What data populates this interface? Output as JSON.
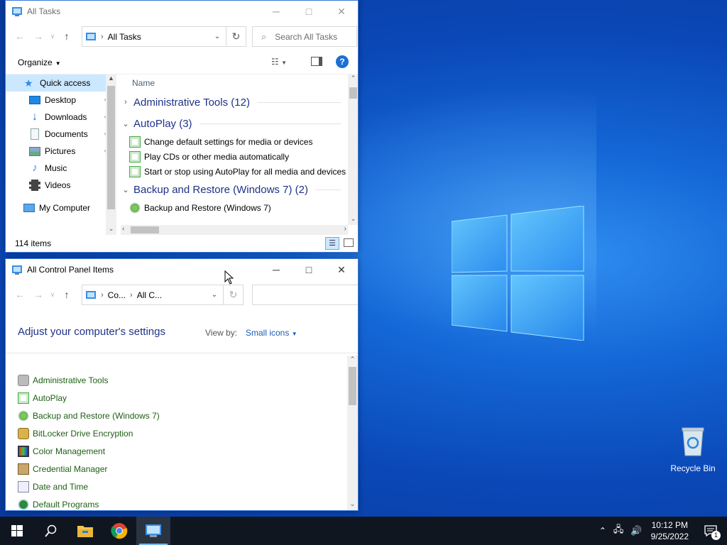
{
  "desktop": {
    "icons": [
      {
        "label": "Recycle Bin",
        "icon": "recycle-bin-icon"
      }
    ]
  },
  "all_tasks_window": {
    "title": "All Tasks",
    "address": {
      "crumbs": [
        "All Tasks"
      ]
    },
    "search_placeholder": "Search All Tasks",
    "toolbar": {
      "organize": "Organize"
    },
    "nav_pane": {
      "items": [
        {
          "label": "Quick access",
          "icon": "star-icon",
          "selected": true
        },
        {
          "label": "Desktop",
          "icon": "desktop-icon",
          "pinned": true
        },
        {
          "label": "Downloads",
          "icon": "download-arrow-icon",
          "pinned": true
        },
        {
          "label": "Documents",
          "icon": "document-icon",
          "pinned": true
        },
        {
          "label": "Pictures",
          "icon": "pictures-icon",
          "pinned": true
        },
        {
          "label": "Music",
          "icon": "music-note-icon"
        },
        {
          "label": "Videos",
          "icon": "video-film-icon"
        },
        {
          "label": "My Computer",
          "icon": "computer-icon"
        }
      ]
    },
    "column_header": "Name",
    "groups": [
      {
        "title": "Administrative Tools (12)",
        "expanded": false,
        "tasks": []
      },
      {
        "title": "AutoPlay (3)",
        "expanded": true,
        "tasks": [
          "Change default settings for media or devices",
          "Play CDs or other media automatically",
          "Start or stop using AutoPlay for all media and devices"
        ]
      },
      {
        "title": "Backup and Restore (Windows 7) (2)",
        "expanded": true,
        "tasks": [
          "Backup and Restore (Windows 7)"
        ]
      }
    ],
    "status": {
      "item_count": "114 items"
    }
  },
  "control_panel_window": {
    "title": "All Control Panel Items",
    "address": {
      "crumbs": [
        "Co...",
        "All C..."
      ]
    },
    "heading": "Adjust your computer's settings",
    "view_by_label": "View by:",
    "view_by_value": "Small icons",
    "items": [
      {
        "label": "Administrative Tools",
        "icon": "admin-tools-icon"
      },
      {
        "label": "AutoPlay",
        "icon": "autoplay-icon"
      },
      {
        "label": "Backup and Restore (Windows 7)",
        "icon": "backup-icon"
      },
      {
        "label": "BitLocker Drive Encryption",
        "icon": "bitlocker-key-icon"
      },
      {
        "label": "Color Management",
        "icon": "color-monitor-icon"
      },
      {
        "label": "Credential Manager",
        "icon": "credential-vault-icon"
      },
      {
        "label": "Date and Time",
        "icon": "calendar-clock-icon"
      },
      {
        "label": "Default Programs",
        "icon": "default-programs-icon"
      }
    ]
  },
  "taskbar": {
    "apps": [
      {
        "name": "start",
        "icon": "windows-logo-icon"
      },
      {
        "name": "search",
        "icon": "search-icon"
      },
      {
        "name": "file-explorer",
        "icon": "folder-icon"
      },
      {
        "name": "chrome",
        "icon": "chrome-icon"
      },
      {
        "name": "control-panel",
        "icon": "control-panel-icon",
        "active": true
      }
    ],
    "clock": {
      "time": "10:12 PM",
      "date": "9/25/2022"
    },
    "notification_count": "1"
  },
  "colors": {
    "group_heading": "#1e3287",
    "cp_link": "#1e5f14",
    "selection": "#cce8ff",
    "taskbar": "#101620",
    "desktop_blue": "#0b49b8"
  }
}
